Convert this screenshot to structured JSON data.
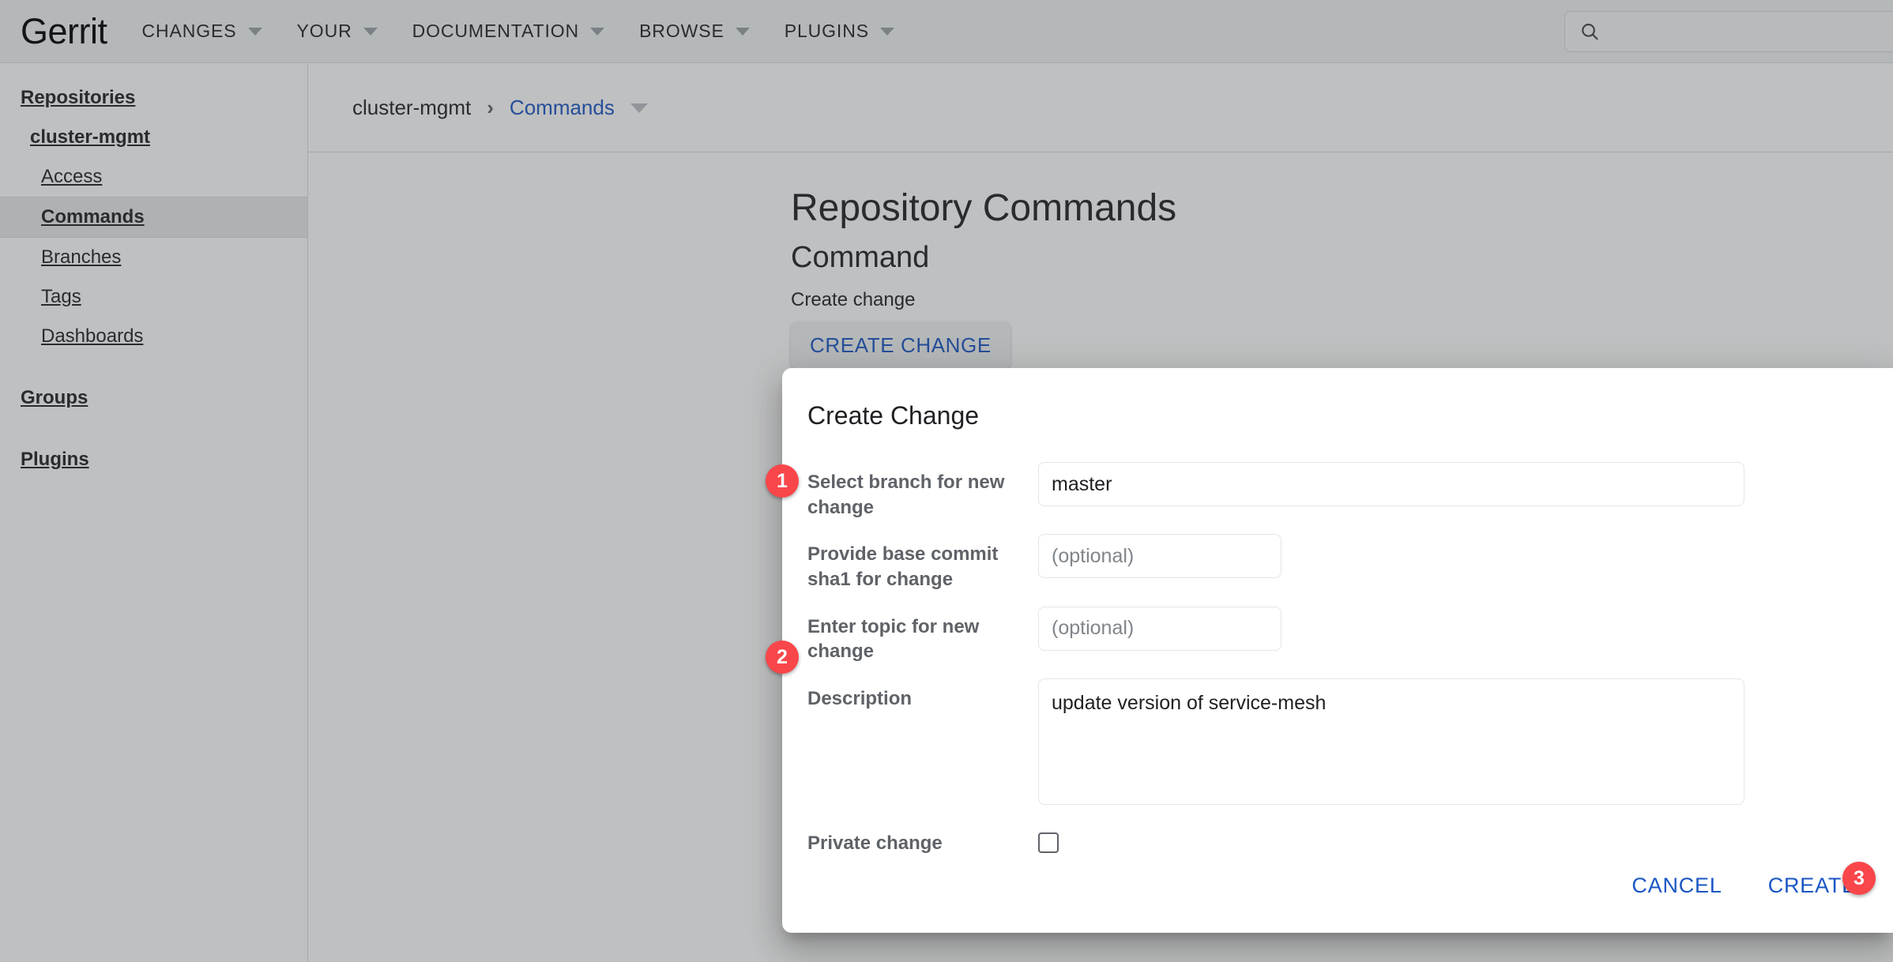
{
  "topbar": {
    "logo": "Gerrit",
    "nav": [
      {
        "label": "CHANGES"
      },
      {
        "label": "YOUR"
      },
      {
        "label": "DOCUMENTATION"
      },
      {
        "label": "BROWSE"
      },
      {
        "label": "PLUGINS"
      }
    ],
    "search": {
      "value": "",
      "placeholder": ""
    }
  },
  "sidebar": {
    "items": [
      {
        "label": "Repositories",
        "level": 0,
        "selected": false
      },
      {
        "label": "cluster-mgmt",
        "level": 1,
        "selected": false
      },
      {
        "label": "Access",
        "level": 2,
        "selected": false
      },
      {
        "label": "Commands",
        "level": 2,
        "selected": true
      },
      {
        "label": "Branches",
        "level": 2,
        "selected": false
      },
      {
        "label": "Tags",
        "level": 2,
        "selected": false
      },
      {
        "label": "Dashboards",
        "level": 2,
        "selected": false
      },
      {
        "label": "Groups",
        "level": 0,
        "selected": false
      },
      {
        "label": "Plugins",
        "level": 0,
        "selected": false
      }
    ]
  },
  "breadcrumb": {
    "repo": "cluster-mgmt",
    "separator": "›",
    "current": "Commands"
  },
  "main": {
    "page_title": "Repository Commands",
    "section_title": "Command",
    "command_label": "Create change",
    "create_change_button": "CREATE CHANGE"
  },
  "dialog": {
    "title": "Create Change",
    "fields": {
      "branch": {
        "label": "Select branch for new change",
        "value": "master",
        "placeholder": ""
      },
      "base_commit": {
        "label": "Provide base commit sha1 for change",
        "value": "",
        "placeholder": "(optional)"
      },
      "topic": {
        "label": "Enter topic for new change",
        "value": "",
        "placeholder": "(optional)"
      },
      "description": {
        "label": "Description",
        "value": "update version of service-mesh",
        "placeholder": ""
      },
      "private_change": {
        "label": "Private change",
        "checked": false
      }
    },
    "actions": {
      "cancel": "CANCEL",
      "create": "CREATE"
    }
  },
  "annotations": {
    "badge_1": "1",
    "badge_2": "2",
    "badge_3": "3"
  },
  "colors": {
    "accent_blue": "#1a56c4",
    "badge_red": "#f9464a",
    "scrim": "rgba(60,64,67,0.33)",
    "selected_row": "#e8eaed"
  }
}
